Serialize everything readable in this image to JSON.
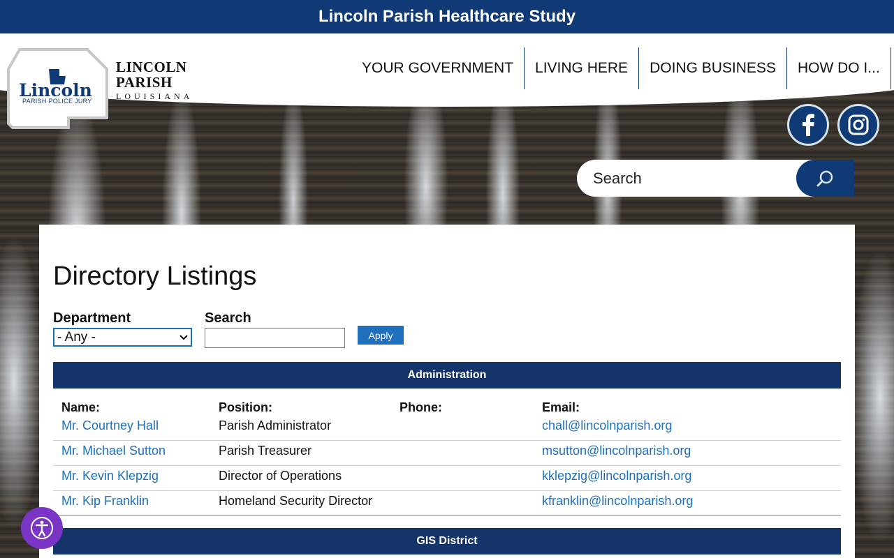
{
  "banner": {
    "text": "Lincoln Parish Healthcare Study"
  },
  "logo": {
    "badge_word": "Lincoln",
    "badge_sub": "PARISH POLICE JURY",
    "line1": "LINCOLN",
    "line2": "PARISH",
    "line3": "LOUISIANA"
  },
  "nav": {
    "items": [
      {
        "label": "YOUR GOVERNMENT"
      },
      {
        "label": "LIVING HERE"
      },
      {
        "label": "DOING BUSINESS"
      },
      {
        "label": "HOW DO I..."
      }
    ]
  },
  "social": {
    "facebook_icon": "facebook-icon",
    "instagram_icon": "instagram-icon"
  },
  "site_search": {
    "label": "Search",
    "icon": "search-icon"
  },
  "page": {
    "title": "Directory Listings"
  },
  "filters": {
    "department_label": "Department",
    "department_value": "- Any -",
    "search_label": "Search",
    "search_value": "",
    "apply_label": "Apply"
  },
  "sections": [
    {
      "name": "Administration",
      "headers": {
        "name": "Name:",
        "position": "Position:",
        "phone": "Phone:",
        "email": "Email:"
      },
      "rows": [
        {
          "name": "Mr. Courtney Hall",
          "position": "Parish Administrator",
          "phone": "",
          "email": "chall@lincolnparish.org"
        },
        {
          "name": "Mr. Michael Sutton",
          "position": "Parish Treasurer",
          "phone": "",
          "email": "msutton@lincolnparish.org"
        },
        {
          "name": "Mr. Kevin Klepzig",
          "position": "Director of Operations",
          "phone": "",
          "email": "kklepzig@lincolnparish.org"
        },
        {
          "name": "Mr. Kip Franklin",
          "position": "Homeland Security Director",
          "phone": "",
          "email": "kfranklin@lincolnparish.org"
        }
      ]
    },
    {
      "name": "GIS District"
    }
  ],
  "accessibility": {
    "icon": "accessibility-icon"
  },
  "colors": {
    "brand_navy": "#0f3a75",
    "section_navy": "#15346a",
    "link_blue": "#1f6fbf",
    "a11y_purple": "#7a35c6"
  }
}
